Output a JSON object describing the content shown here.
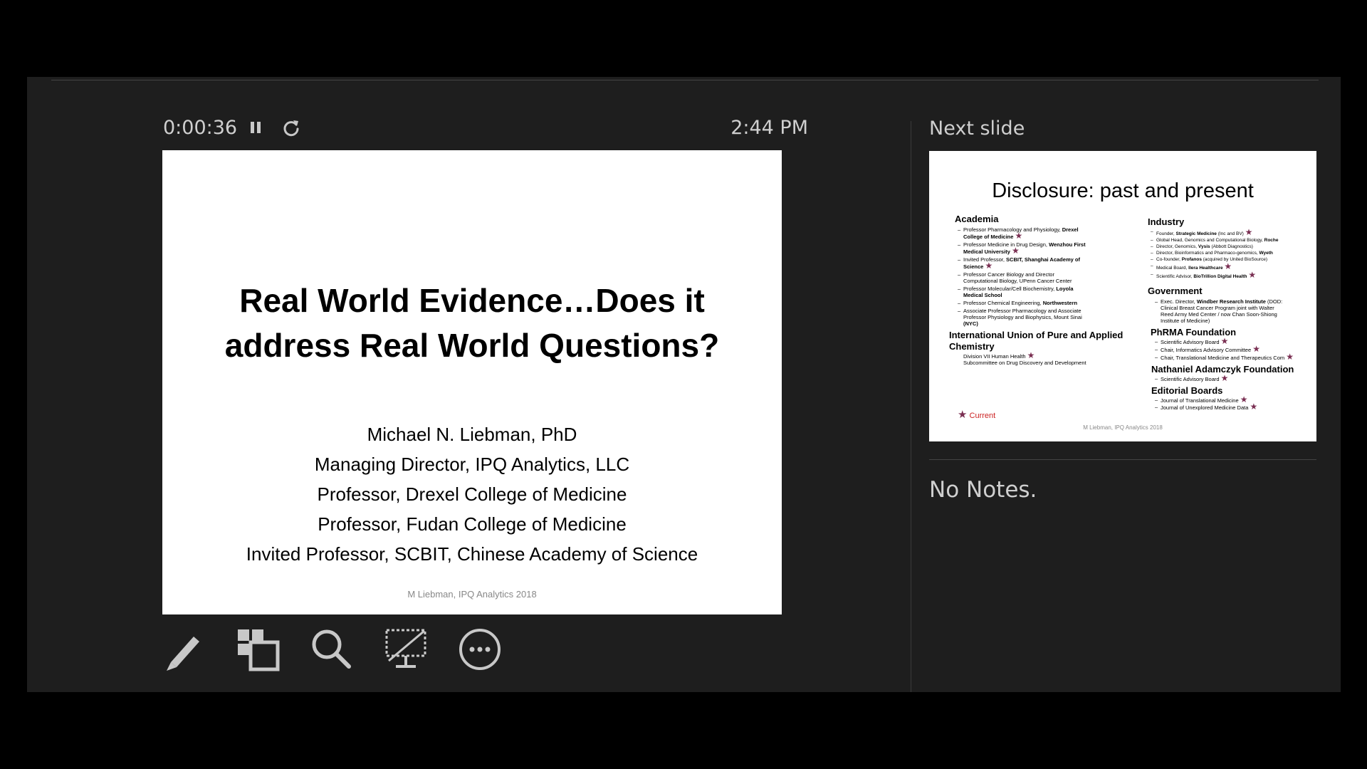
{
  "header": {
    "timer": "0:00:36",
    "clock": "2:44 PM"
  },
  "current_slide": {
    "title_lines": [
      "Real World Evidence…Does it",
      "address Real World Questions?"
    ],
    "subtitle_lines": [
      "Michael N. Liebman, PhD",
      "Managing Director, IPQ Analytics, LLC",
      "Professor, Drexel College of Medicine",
      "Professor, Fudan College of Medicine",
      "Invited Professor, SCBIT, Chinese Academy of Science"
    ],
    "footer": "M Liebman, IPQ Analytics 2018"
  },
  "toolbar": {
    "tools": [
      {
        "icon": "pen-icon"
      },
      {
        "icon": "see-all-slides-icon"
      },
      {
        "icon": "zoom-icon"
      },
      {
        "icon": "black-screen-icon"
      },
      {
        "icon": "more-options-icon"
      }
    ]
  },
  "next_panel": {
    "label": "Next slide",
    "slide": {
      "title": "Disclosure: past and present",
      "academia": {
        "heading": "Academia",
        "items": [
          {
            "text": "Professor Pharmacology and Physiology, ",
            "bold": "Drexel",
            "line2": "College of Medicine",
            "line2_bold": true,
            "star": true
          },
          {
            "text": "Professor Medicine in Drug Design, ",
            "bold": "Wenzhou First",
            "line2": "Medical University",
            "line2_bold": true,
            "star": true
          },
          {
            "text": "Invited Professor, ",
            "bold": "SCBIT, Shanghai Academy of",
            "line2": "Science",
            "line2_bold": true,
            "star": true
          },
          {
            "text": "Professor Cancer Biology and Director",
            "bold": "",
            "line2": "Computational Biology, UPenn Cancer Center",
            "line2_bold": false,
            "star": false
          },
          {
            "text": "Professor Molecular/Cell Biochemistry, ",
            "bold": "Loyola",
            "line2": "Medical School",
            "line2_bold": true,
            "star": false
          },
          {
            "text": "Professor Chemical Engineering, ",
            "bold": "Northwestern",
            "line2": "",
            "line2_bold": false,
            "star": false
          },
          {
            "text": "Associate Professor Pharmacology and Associate",
            "bold": "",
            "line2": "Professor Physiology and Biophysics, Mount Sinai",
            "line2_bold": false,
            "line3": "(NYC)",
            "star": false
          }
        ]
      },
      "iupac": {
        "heading_lines": [
          "International Union of Pure and Applied",
          "Chemistry"
        ],
        "subs": [
          {
            "text": "Division VII Human Health",
            "star": true
          },
          {
            "text": "Subcommittee on Drug Discovery and Development",
            "star": false
          }
        ]
      },
      "industry": {
        "heading": "Industry",
        "items": [
          {
            "text": "Founder, ",
            "bold": "Strategic Medicine",
            "rest": " (Inc and BV)",
            "star": true
          },
          {
            "text": "Global Head, Genomics and Computational Biology, ",
            "bold": "Roche",
            "rest": "",
            "star": false
          },
          {
            "text": "Director, Genomics, ",
            "bold": "Vysis",
            "rest": " (Abbott Diagnostics)",
            "star": false
          },
          {
            "text": "Director, Bioinformatics and Pharmaco-genomics, ",
            "bold": "Wyeth",
            "rest": "",
            "star": false
          },
          {
            "text": "Co-founder, ",
            "bold": "Profanos",
            "rest": " (acquired by United BioSource)",
            "star": false
          },
          {
            "text": "Medical Board, ",
            "bold": "Ilera Healthcare",
            "rest": "",
            "star": true
          },
          {
            "text": "Scientific Advisor, ",
            "bold": "BioTrillion Digital Health",
            "rest": "",
            "star": true
          }
        ]
      },
      "government": {
        "heading": "Government",
        "items": [
          {
            "text": "Exec. Director, ",
            "bold": "Windber Research Institute",
            "rest": " (DOD:",
            "line2": "Clinical Breast Cancer Program joint with Walter",
            "line3": "Reed Army Med Center / now Chan Soon-Shiong",
            "line4": "Institute of Medicine)"
          }
        ]
      },
      "phrma": {
        "heading": "PhRMA Foundation",
        "items": [
          {
            "text": "Scientific Advisory Board",
            "star": true
          },
          {
            "text": "Chair, Informatics Advisory Committee",
            "star": true
          },
          {
            "text": "Chair, Translational Medicine and Therapeutics Com",
            "star": true
          }
        ]
      },
      "adamczyk": {
        "heading": "Nathaniel Adamczyk Foundation",
        "items": [
          {
            "text": "Scientific Advisory Board",
            "star": true
          }
        ]
      },
      "editorial": {
        "heading": "Editorial Boards",
        "items": [
          {
            "text": "Journal of Translational Medicine",
            "star": true
          },
          {
            "text": "Journal of Unexplored Medicine Data",
            "star": true
          }
        ]
      },
      "current_label": "Current",
      "footer": "M Liebman, IPQ Analytics 2018"
    }
  },
  "notes": {
    "text": "No Notes."
  },
  "colors": {
    "panel_bg": "#1e1e1e",
    "text_light": "#cfcfcf",
    "icon": "#c8c8c8",
    "star": "#7a2f52",
    "current_red": "#cc2222"
  }
}
